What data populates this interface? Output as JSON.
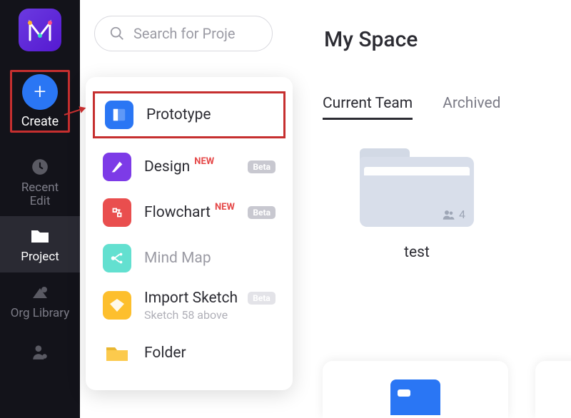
{
  "sidebar": {
    "create_label": "Create",
    "items": [
      {
        "label": "Recent\nEdit"
      },
      {
        "label": "Project"
      },
      {
        "label": "Org Library"
      }
    ]
  },
  "search": {
    "placeholder": "Search for Proje"
  },
  "create_menu": {
    "items": [
      {
        "label": "Prototype"
      },
      {
        "label": "Design",
        "new": "NEW",
        "beta": "Beta"
      },
      {
        "label": "Flowchart",
        "new": "NEW",
        "beta": "Beta"
      },
      {
        "label": "Mind Map"
      },
      {
        "label": "Import Sketch",
        "beta": "Beta",
        "sub": "Sketch 58 above"
      },
      {
        "label": "Folder"
      }
    ]
  },
  "main": {
    "title": "My Space",
    "tabs": [
      "Current Team",
      "Archived"
    ],
    "folder": {
      "name": "test",
      "member_count": "4"
    }
  }
}
